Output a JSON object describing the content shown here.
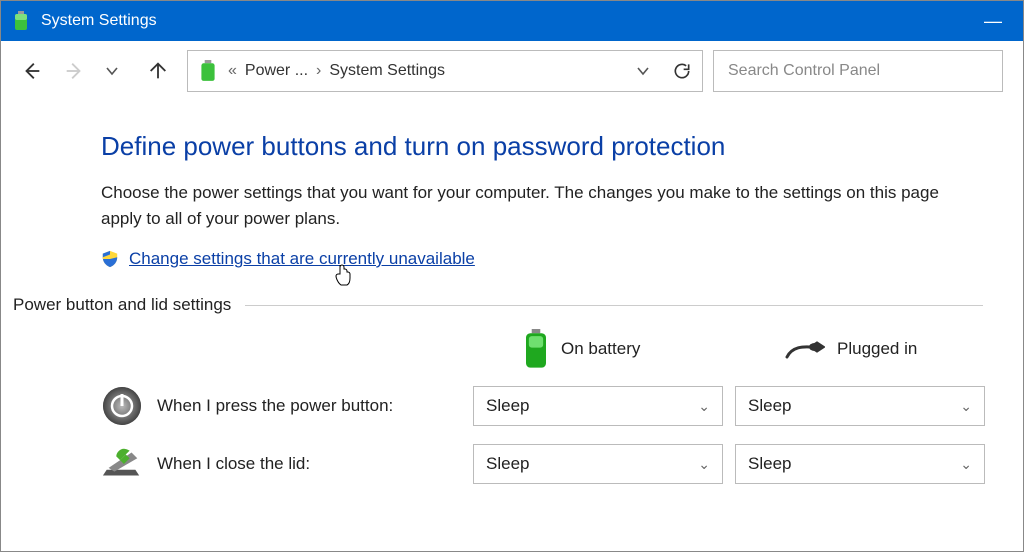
{
  "titlebar": {
    "title": "System Settings"
  },
  "breadcrumb": {
    "parent": "Power ...",
    "current": "System Settings"
  },
  "search": {
    "placeholder": "Search Control Panel"
  },
  "page": {
    "heading": "Define power buttons and turn on password protection",
    "desc": "Choose the power settings that you want for your computer. The changes you make to the settings on this page apply to all of your power plans.",
    "uac_link": "Change settings that are currently unavailable",
    "section": "Power button and lid settings",
    "col_battery": "On battery",
    "col_plugged": "Plugged in",
    "rows": [
      {
        "label": "When I press the power button:",
        "battery": "Sleep",
        "plugged": "Sleep"
      },
      {
        "label": "When I close the lid:",
        "battery": "Sleep",
        "plugged": "Sleep"
      }
    ]
  }
}
